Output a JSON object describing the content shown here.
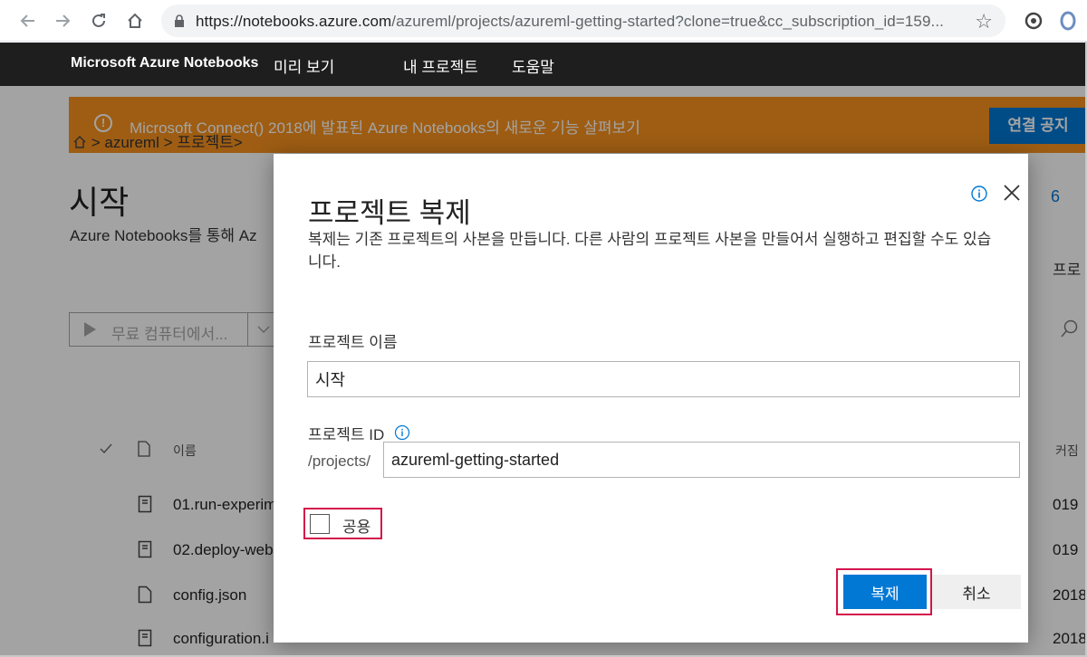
{
  "browser": {
    "url_host": "https://notebooks.azure.com",
    "url_path": "/azureml/projects/azureml-getting-started?clone=true&cc_subscription_id=159..."
  },
  "topnav": {
    "brand": "Microsoft Azure Notebooks",
    "preview": "미리 보기",
    "my_projects": "내 프로젝트",
    "help": "도움말"
  },
  "banner": {
    "text": "Microsoft Connect() 2018에 발표된 Azure Notebooks의 새로운 기능 살펴보기",
    "button": "연결 공지",
    "color": "#f7921e"
  },
  "breadcrumb": {
    "text": "> azureml > 프로젝트>"
  },
  "page": {
    "title": "시작",
    "subtitle": "Azure Notebooks를 통해 Az",
    "right_number": "6",
    "right_text": "프로"
  },
  "toolbar": {
    "run_label": "무료 컴퓨터에서..."
  },
  "files": {
    "header_name": "이름",
    "header_modified": "커짐",
    "rows": [
      {
        "name": "01.run-experim",
        "date": "019",
        "icon": "notebook-icon"
      },
      {
        "name": "02.deploy-web",
        "date": "019",
        "icon": "notebook-icon"
      },
      {
        "name": "config.json",
        "date": "2018",
        "icon": "file-icon"
      },
      {
        "name": "configuration.i",
        "date": "2018",
        "icon": "notebook-icon"
      }
    ]
  },
  "dialog": {
    "title": "프로젝트 복제",
    "description": "복제는 기존 프로젝트의 사본을 만듭니다. 다른 사람의 프로젝트 사본을 만들어서 실행하고 편집할 수도 있습니다.",
    "name_label": "프로젝트 이름",
    "name_value": "시작",
    "id_label": "프로젝트 ID",
    "id_prefix": "/projects/",
    "id_value": "azureml-getting-started",
    "public_label": "공용",
    "public_checked": false,
    "clone_button": "복제",
    "cancel_button": "취소",
    "accent_color": "#0078d4",
    "highlight_color": "#d4154b"
  }
}
